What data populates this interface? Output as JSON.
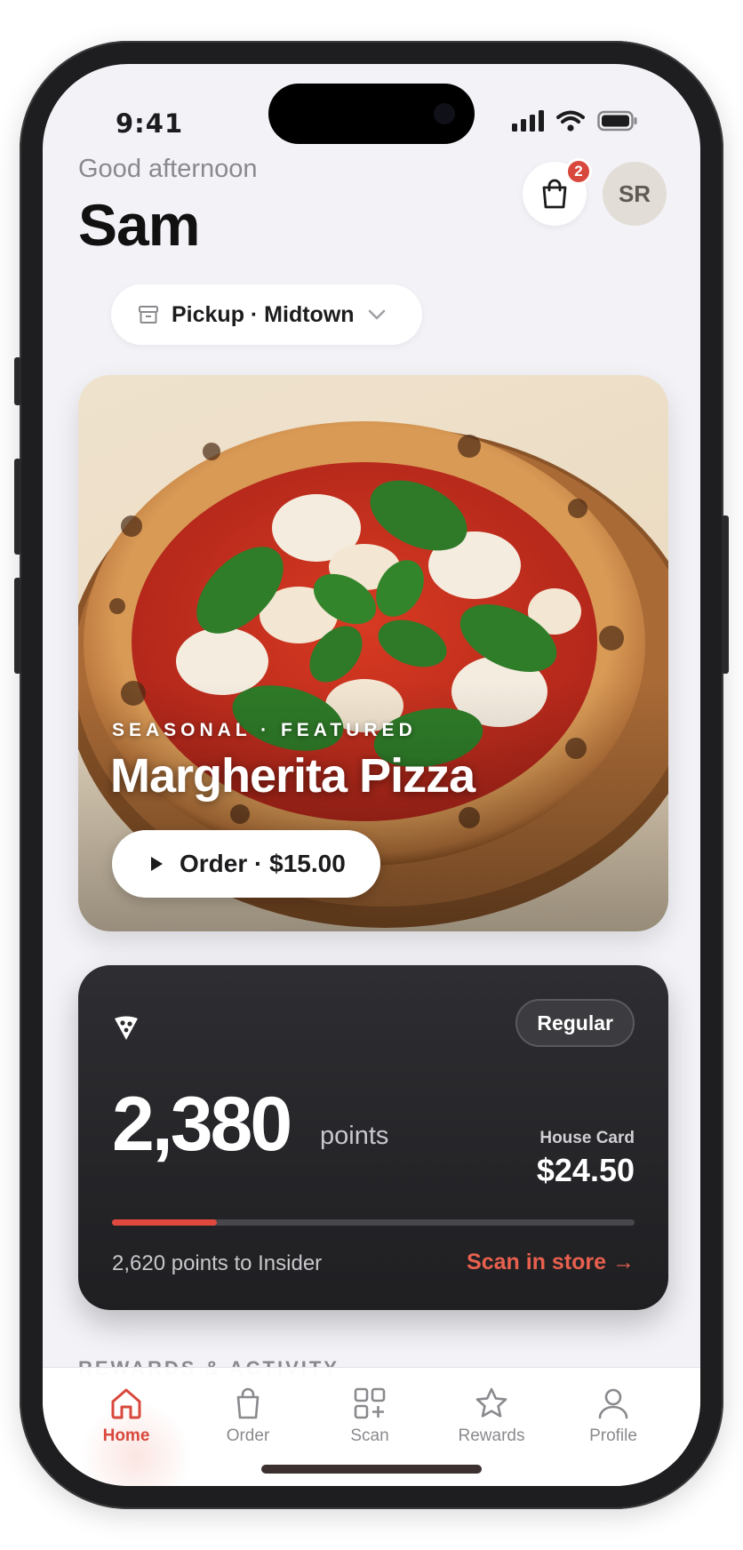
{
  "status_bar": {
    "time": "9:41"
  },
  "header": {
    "greeting": "Good afternoon",
    "user_name": "Sam",
    "cart_count": "2",
    "avatar_initials": "SR"
  },
  "location": {
    "label": "Pickup · Midtown"
  },
  "featured": {
    "tag": "SEASONAL · FEATURED",
    "title": "Margherita Pizza",
    "order_label": "Order · $15.00"
  },
  "rewards_card": {
    "tier": "Regular",
    "points": "2,380",
    "points_unit": "points",
    "house_card_label": "House Card",
    "house_card_balance": "$24.50",
    "progress_fraction": 0.2,
    "to_next_tier": "2,620 points to Insider",
    "scan_label": "Scan in store →"
  },
  "section_title": "REWARDS & ACTIVITY",
  "tabbar": {
    "tabs": [
      {
        "label": "Home",
        "icon": "home-icon",
        "active": true
      },
      {
        "label": "Order",
        "icon": "bag-icon",
        "active": false
      },
      {
        "label": "Scan",
        "icon": "scan-icon",
        "active": false
      },
      {
        "label": "Rewards",
        "icon": "star-icon",
        "active": false
      },
      {
        "label": "Profile",
        "icon": "person-icon",
        "active": false
      }
    ]
  },
  "colors": {
    "accent": "#d8483c",
    "card_bg": "#2a2a2e",
    "screen_bg": "#f2f2f7"
  }
}
